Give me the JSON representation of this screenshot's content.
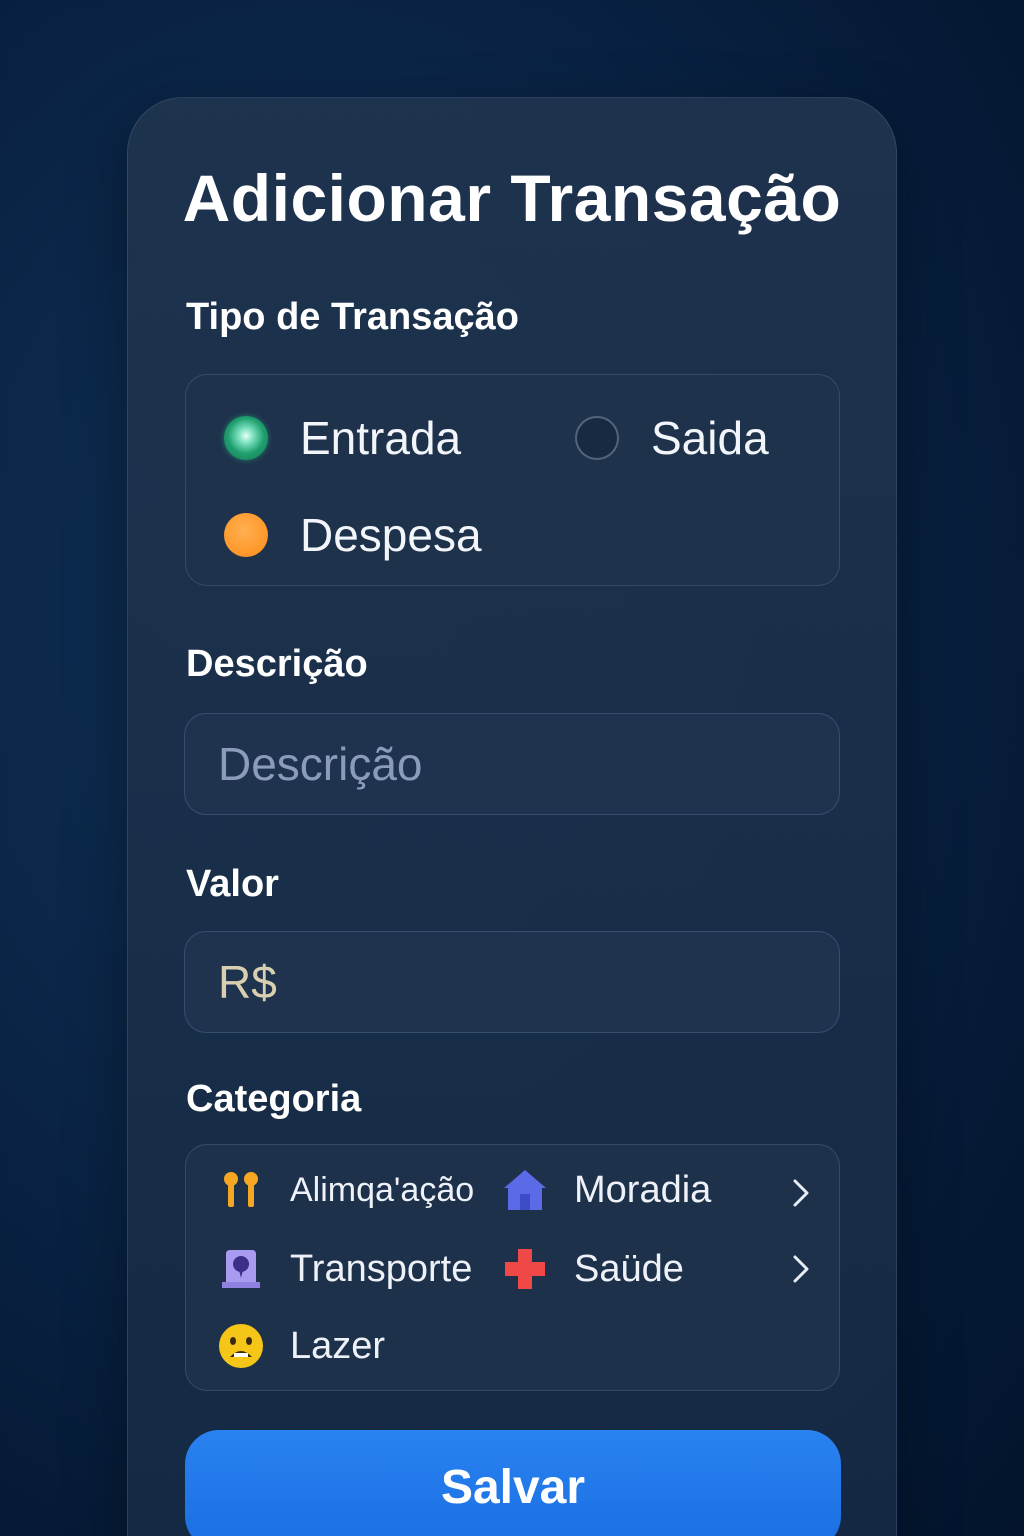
{
  "form": {
    "title": "Adicionar Transação",
    "save_label": "Salvar"
  },
  "transaction_type": {
    "label": "Tipo de Transação",
    "options": [
      {
        "label": "Entrada",
        "state": "selected",
        "color": "#1f9e6e"
      },
      {
        "label": "Saida",
        "state": "unselected",
        "color": "#7f93ad"
      },
      {
        "label": "Despesa",
        "state": "marked",
        "color": "#ff9a2e"
      }
    ]
  },
  "description": {
    "label": "Descrição",
    "placeholder": "Descrição",
    "value": ""
  },
  "amount": {
    "label": "Valor",
    "placeholder": "R$",
    "value": ""
  },
  "category": {
    "label": "Categoria",
    "items": [
      {
        "label": "Alimqa'ação",
        "icon": "utensils-icon",
        "color": "#f5a623"
      },
      {
        "label": "Moradia",
        "icon": "house-icon",
        "color": "#5b6be8"
      },
      {
        "label": "Transporte",
        "icon": "transport-icon",
        "color": "#a99cf0"
      },
      {
        "label": "Saüde",
        "icon": "health-cross-icon",
        "color": "#f04747"
      },
      {
        "label": "Lazer",
        "icon": "emoji-face-icon",
        "color": "#f5c518"
      }
    ]
  },
  "theme": {
    "accent": "#1f75e8",
    "background": "#0a2445"
  }
}
